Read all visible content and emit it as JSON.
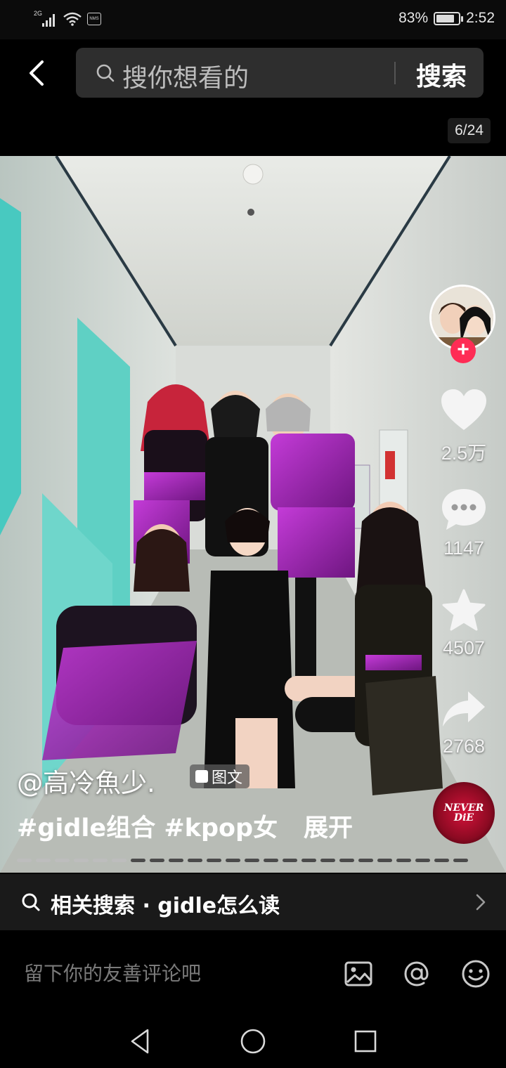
{
  "status_bar": {
    "network": "2G",
    "battery": "83%",
    "battery_level": 0.83,
    "time": "2:52"
  },
  "header": {
    "search_placeholder": "搜你想看的",
    "search_button": "搜索",
    "page_counter": "6/24"
  },
  "actions": {
    "likes": "2.5万",
    "comments": "1147",
    "favorites": "4507",
    "shares": "2768"
  },
  "caption": {
    "author": "@高冷魚少.",
    "badge": "图文",
    "tags": "#gidle组合 #kpop女",
    "expand": "展开"
  },
  "music": {
    "cover_text_line1": "NEVER",
    "cover_text_line2": "DiE"
  },
  "carousel": {
    "total": 24,
    "current": 6
  },
  "related": {
    "text": "相关搜索 · gidle怎么读"
  },
  "comment_bar": {
    "placeholder": "留下你的友善评论吧"
  },
  "icons": {
    "back": "back-arrow-icon",
    "search": "search-icon",
    "like": "heart-icon",
    "comment": "comment-bubble-icon",
    "favorite": "star-icon",
    "share": "share-arrow-icon",
    "image": "image-icon",
    "at": "at-icon",
    "emoji": "emoji-icon"
  },
  "colors": {
    "accent": "#fe2c55",
    "background": "#000000",
    "panel": "#1a1a1a"
  }
}
